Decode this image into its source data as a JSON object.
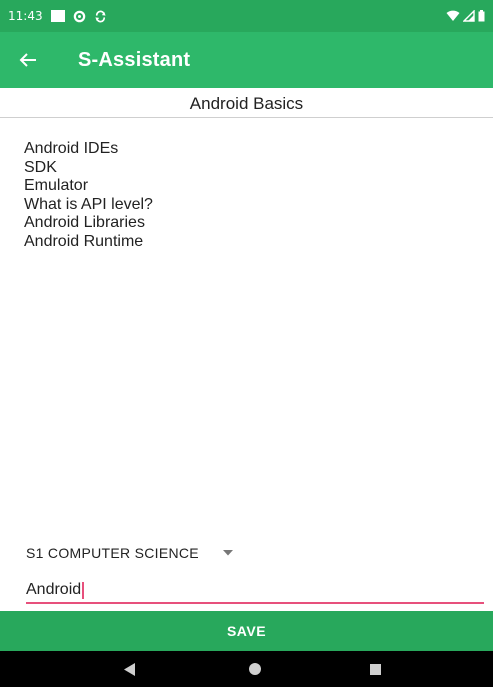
{
  "status_bar": {
    "time": "11:43",
    "icons_left": [
      "notification-square-icon",
      "settings-gear-icon",
      "sync-icon"
    ],
    "icons_right": [
      "wifi-icon",
      "signal-icon",
      "battery-icon"
    ]
  },
  "app_bar": {
    "title": "S-Assistant",
    "back_icon": "arrow-left-icon"
  },
  "category": {
    "title": "Android Basics"
  },
  "topics": [
    "Android IDEs",
    "SDK",
    "Emulator",
    "What is API level?",
    "Android Libraries",
    "Android Runtime"
  ],
  "dropdown": {
    "selected": "S1 COMPUTER SCIENCE"
  },
  "text_field": {
    "value": "Android"
  },
  "save_button": {
    "label": "SAVE"
  },
  "colors": {
    "status_bar": "#28a85c",
    "app_bar": "#2eb86a",
    "save_button": "#28a85c",
    "accent": "#e7507c",
    "nav_bar": "#000000"
  },
  "nav_bar": {
    "buttons": [
      "back-triangle-icon",
      "home-circle-icon",
      "recents-square-icon"
    ]
  }
}
